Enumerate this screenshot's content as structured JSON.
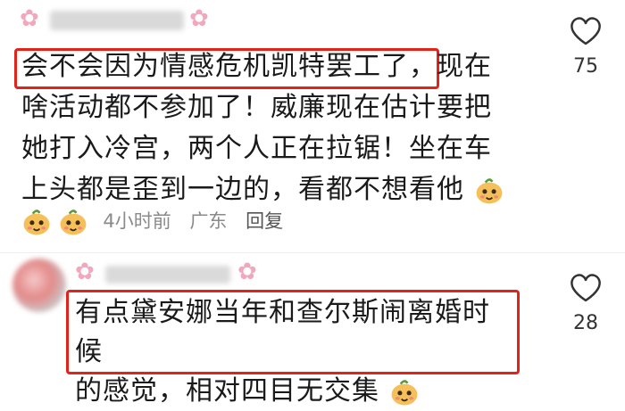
{
  "comments": [
    {
      "lines": [
        "会不会因为情感危机凯特罢工了，现在",
        "啥活动都不参加了！威廉现在估计要把",
        "她打入冷宫，两个人正在拉锯！坐在车",
        "上头都是歪到一边的，看都不想看他"
      ],
      "highlight": "会不会因为情感危机凯特罢工了，",
      "like_count": "75",
      "time": "4小时前",
      "location": "广东",
      "reply_label": "回复"
    },
    {
      "lines": [
        "有点黛安娜当年和查尔斯闹离婚时候",
        "的感觉，相对四目无交集"
      ],
      "like_count": "28"
    }
  ],
  "icons": {
    "like": "heart-outline-icon",
    "emoji": "pear-face-emoji-icon",
    "flower": "pink-flower-icon"
  },
  "colors": {
    "highlight_border": "#e2231a",
    "meta_text": "#8a8a8a"
  }
}
